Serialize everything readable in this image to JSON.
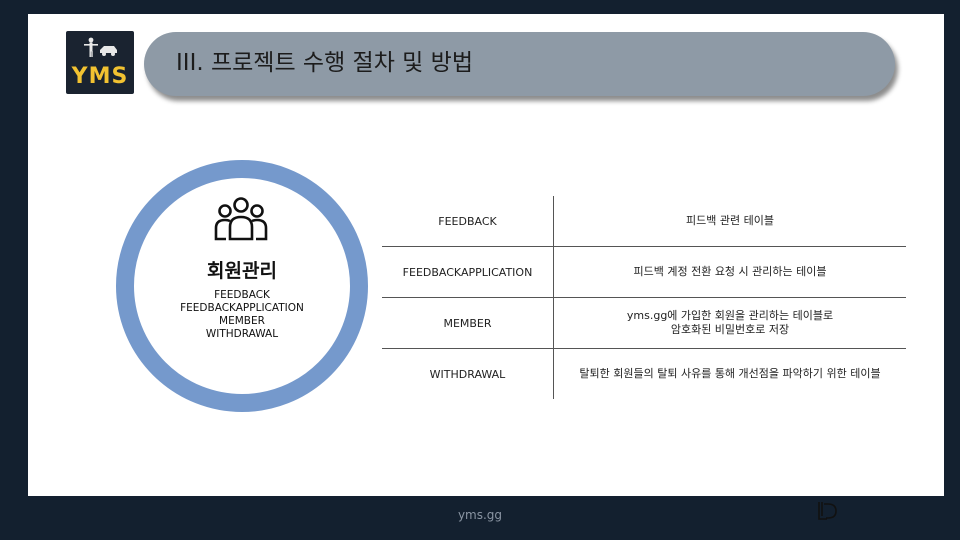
{
  "logo": {
    "text": "YMS"
  },
  "header": {
    "title": "III. 프로젝트 수행 절차 및 방법"
  },
  "ring": {
    "title": "회원관리",
    "items": [
      "FEEDBACK",
      "FEEDBACKAPPLICATION",
      "MEMBER",
      "WITHDRAWAL"
    ],
    "icon": "people-group-icon",
    "color": "#7599cc"
  },
  "table": {
    "rows": [
      {
        "name": "FEEDBACK",
        "desc": "피드백 관련 테이블"
      },
      {
        "name": "FEEDBACKAPPLICATION",
        "desc": "피드백 계정 전환 요청 시 관리하는 테이블"
      },
      {
        "name": "MEMBER",
        "desc": "yms.gg에 가입한 회원을 관리하는 테이블로\n암호화된 비밀번호로 저장"
      },
      {
        "name": "WITHDRAWAL",
        "desc": "탈퇴한 회원들의 탈퇴 사유를 통해 개선점을 파악하기 위한 테이블"
      }
    ]
  },
  "footer": {
    "text": "yms.gg",
    "mark_icon": "ld-monogram-icon"
  },
  "colors": {
    "background": "#13202f",
    "title_bar": "#8e9aa6",
    "accent": "#f2c231"
  }
}
